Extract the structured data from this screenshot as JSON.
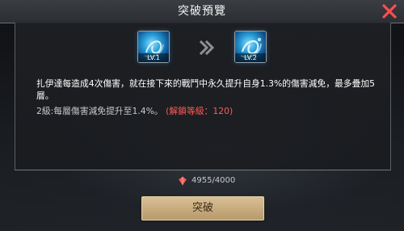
{
  "header": {
    "title": "突破預覽",
    "close_icon": "close-icon"
  },
  "breakthrough": {
    "current_level_label": "LV.1",
    "next_level_label": "LV.2",
    "arrow_icon": "double-chevron-right-icon",
    "description": "扎伊達每造成4次傷害，就在接下來的戰鬥中永久提升自身1.3%的傷害減免，最多疊加5層。",
    "level2_text": "2級:每層傷害減免提升至1.4%。",
    "unlock_text": "(解鎖等級：120)",
    "unlock_color": "#ff5b57"
  },
  "cost": {
    "icon": "crystal-icon",
    "value": "4955/4000"
  },
  "button": {
    "label": "突破"
  }
}
